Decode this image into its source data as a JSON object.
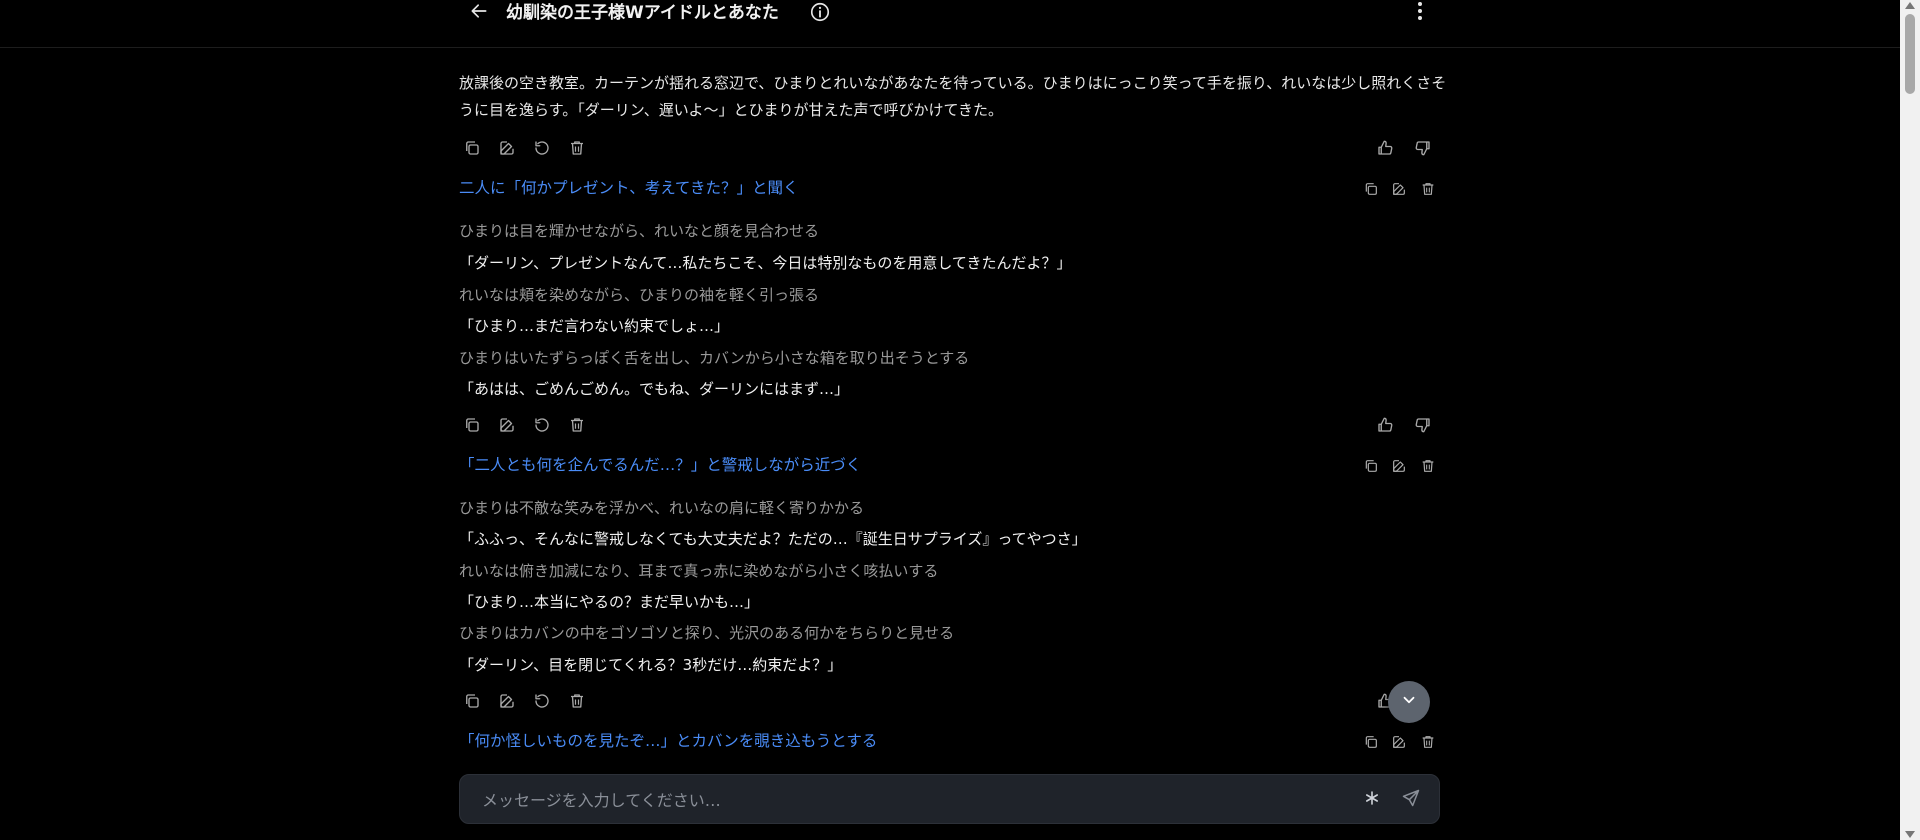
{
  "header": {
    "title": "幼馴染の王子様Wアイドルとあなた",
    "back_icon": "arrow-left-icon",
    "info_icon": "info-icon",
    "menu_icon": "more-vertical-icon"
  },
  "messages": [
    {
      "role": "ai",
      "lines": [
        {
          "kind": "main",
          "text": "放課後の空き教室。カーテンが揺れる窓辺で、ひまりとれいながあなたを待っている。ひまりはにっこり笑って手を振り、れいなは少し照れくさそうに目を逸らす。「ダーリン、遅いよ〜」とひまりが甘えた声で呼びかけてきた。"
        }
      ]
    },
    {
      "role": "user",
      "text": "二人に「何かプレゼント、考えてきた？」と聞く"
    },
    {
      "role": "ai",
      "lines": [
        {
          "kind": "narr",
          "text": "ひまりは目を輝かせながら、れいなと顔を見合わせる"
        },
        {
          "kind": "speech",
          "text": "「ダーリン、プレゼントなんて…私たちこそ、今日は特別なものを用意してきたんだよ？」"
        },
        {
          "kind": "narr",
          "text": "れいなは頬を染めながら、ひまりの袖を軽く引っ張る"
        },
        {
          "kind": "speech",
          "text": "「ひまり…まだ言わない約束でしょ…」"
        },
        {
          "kind": "narr",
          "text": "ひまりはいたずらっぽく舌を出し、カバンから小さな箱を取り出そうとする"
        },
        {
          "kind": "speech",
          "text": "「あはは、ごめんごめん。でもね、ダーリンにはまず…」"
        }
      ]
    },
    {
      "role": "user",
      "text": "「二人とも何を企んでるんだ…？」と警戒しながら近づく"
    },
    {
      "role": "ai",
      "lines": [
        {
          "kind": "narr",
          "text": "ひまりは不敵な笑みを浮かべ、れいなの肩に軽く寄りかかる"
        },
        {
          "kind": "speech",
          "text": "「ふふっ、そんなに警戒しなくても大丈夫だよ？ただの…『誕生日サプライズ』ってやつさ」"
        },
        {
          "kind": "narr",
          "text": "れいなは俯き加減になり、耳まで真っ赤に染めながら小さく咳払いする"
        },
        {
          "kind": "speech",
          "text": "「ひまり…本当にやるの？まだ早いかも…」"
        },
        {
          "kind": "narr",
          "text": "ひまりはカバンの中をゴソゴソと探り、光沢のある何かをちらりと見せる"
        },
        {
          "kind": "speech",
          "text": "「ダーリン、目を閉じてくれる？3秒だけ…約束だよ？」"
        }
      ]
    },
    {
      "role": "user",
      "text": "「何か怪しいものを見たぞ…」とカバンを覗き込もうとする"
    }
  ],
  "input": {
    "placeholder": "メッセージを入力してください…",
    "value": ""
  },
  "icons": {
    "copy": "copy-icon",
    "edit": "edit-icon",
    "regenerate": "regenerate-icon",
    "delete": "trash-icon",
    "like": "thumbs-up-icon",
    "dislike": "thumbs-down-icon",
    "scroll_down": "chevron-down-icon",
    "asterisk": "asterisk-icon",
    "send": "send-icon"
  },
  "colors": {
    "background": "#000000",
    "user_text": "#4a8cf7",
    "narration_text": "#9a9a9a",
    "speech_text": "#f0f0f0",
    "input_bg": "#1f232a"
  }
}
